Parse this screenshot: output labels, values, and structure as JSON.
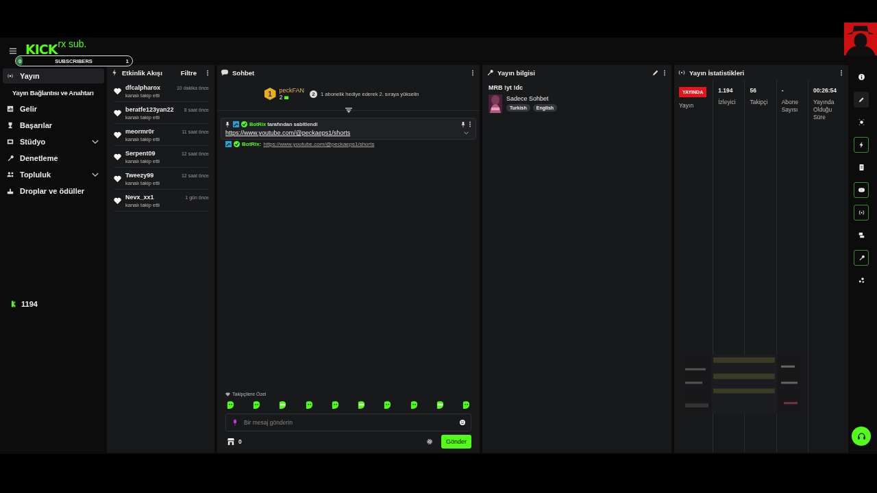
{
  "overlay": {
    "logo": "KICK",
    "sub_text": "rx sub.",
    "bar_label": "SUBSCRIBERS",
    "bar_start": "0",
    "bar_end": "1",
    "level": 0.06
  },
  "sidebar": {
    "items": [
      {
        "label": "Yayın",
        "kind": "main",
        "selected": true
      },
      {
        "label": "Yayın Bağlantısı ve Anahtarı",
        "kind": "sub",
        "selected": false
      },
      {
        "label": "Gelir",
        "kind": "main",
        "selected": false
      },
      {
        "label": "Başarılar",
        "kind": "main",
        "selected": false
      },
      {
        "label": "Stüdyo",
        "kind": "main",
        "selected": false,
        "expanded": false
      },
      {
        "label": "Denetleme",
        "kind": "main",
        "selected": false
      },
      {
        "label": "Topluluk",
        "kind": "main",
        "selected": false,
        "expanded": false
      },
      {
        "label": "Droplar ve ödüller",
        "kind": "main",
        "selected": false
      }
    ],
    "viewer_count": "1194"
  },
  "activity": {
    "title": "Etkinlik Akışı",
    "filter": "Filtre",
    "events": [
      {
        "user": "dfcalpharox",
        "action": "kanalı takip etti",
        "time": "10 dakika önce"
      },
      {
        "user": "beratfe123yan22",
        "action": "kanalı takip etti",
        "time": "8 saat önce"
      },
      {
        "user": "meormr0r",
        "action": "kanalı takip etti",
        "time": "11 saat önce"
      },
      {
        "user": "Serpent09",
        "action": "kanalı takip etti",
        "time": "12 saat önce"
      },
      {
        "user": "Tweezy99",
        "action": "kanalı takip etti",
        "time": "12 saat önce"
      },
      {
        "user": "Nevx_xx1",
        "action": "kanalı takip etti",
        "time": "1 gün önce"
      }
    ]
  },
  "chat": {
    "title": "Sohbet",
    "leader": {
      "rank": "1",
      "name": "peckFAN",
      "count": "2"
    },
    "goal": {
      "rank": "2",
      "text": "1 abonelik hediye ederek 2. sıraya yükselin"
    },
    "pinned": {
      "by": "BotRix",
      "by_suffix": "tarafından sabitlendi",
      "link": "https://www.youtube.com/@peckaeps1/shorts"
    },
    "messages": [
      {
        "user": "BotRix:",
        "text": "https://www.youtube.com/@peckaeps1/shorts"
      }
    ],
    "emote_section": "Takipçilere Özel",
    "placeholder": "Bir mesaj gönderin",
    "points": "0",
    "send": "Gönder"
  },
  "stream_info": {
    "title": "Yayın bilgisi",
    "stream_title": "MRB !yt !dc",
    "category": "Sadece Sohbet",
    "tags": [
      "Turkish",
      "English"
    ]
  },
  "stats": {
    "title": "Yayın İstatistikleri",
    "status": "YAYINDA",
    "columns": [
      {
        "label": "Yayın"
      },
      {
        "value": "1.194",
        "label": "İzleyici"
      },
      {
        "value": "56",
        "label": "Takipçi"
      },
      {
        "value": "-",
        "label": "Abone Sayısı"
      },
      {
        "value": "00:26:54",
        "label": "Yayında Olduğu Süre"
      }
    ]
  },
  "rail": [
    {
      "on": false
    },
    {
      "on": false
    },
    {
      "on": false
    },
    {
      "on": true
    },
    {
      "on": false
    },
    {
      "on": true
    },
    {
      "on": true
    },
    {
      "on": false
    },
    {
      "on": true
    },
    {
      "on": false
    }
  ]
}
